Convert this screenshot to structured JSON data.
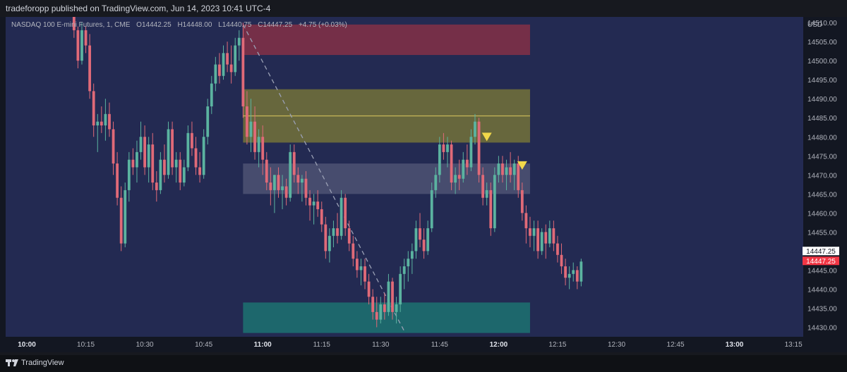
{
  "header": {
    "publisher_line": "tradeforopp published on TradingView.com, Jun 14, 2023 10:41 UTC-4"
  },
  "legend": {
    "symbol": "NASDAQ 100 E-mini Futures, 1, CME",
    "open": "O14442.25",
    "high": "H14448.00",
    "low": "L14440.75",
    "close": "C14447.25",
    "change": "+4.75 (+0.03%)"
  },
  "price_axis": {
    "currency": "USD",
    "last_price": "14447.25",
    "last_price_red": "14447.25"
  },
  "footer": {
    "brand": "TradingView"
  },
  "colors": {
    "up": "#5bb3a0",
    "down": "#e06a78",
    "background": "#232a52",
    "supply_zone": "#7a2f48",
    "premium_zone": "#6b6a3c",
    "fvg_zone": "#4a4e70",
    "demand_zone": "#1e6a6e",
    "marker": "#f2d84a"
  },
  "chart_data": {
    "type": "candlestick",
    "title": "",
    "ylim": [
      14427.5,
      14511.5
    ],
    "x_ticks": [
      {
        "label": "10:00",
        "minute": 0,
        "bold": true
      },
      {
        "label": "10:15",
        "minute": 15
      },
      {
        "label": "10:30",
        "minute": 30
      },
      {
        "label": "10:45",
        "minute": 45
      },
      {
        "label": "11:00",
        "minute": 60,
        "bold": true
      },
      {
        "label": "11:15",
        "minute": 75
      },
      {
        "label": "11:30",
        "minute": 90
      },
      {
        "label": "11:45",
        "minute": 105
      },
      {
        "label": "12:00",
        "minute": 120,
        "bold": true
      },
      {
        "label": "12:15",
        "minute": 135
      },
      {
        "label": "12:30",
        "minute": 150
      },
      {
        "label": "12:45",
        "minute": 165
      },
      {
        "label": "13:00",
        "minute": 180,
        "bold": true
      },
      {
        "label": "13:15",
        "minute": 195
      }
    ],
    "y_ticks": [
      14510,
      14505,
      14500,
      14495,
      14490,
      14485,
      14480,
      14475,
      14470,
      14465,
      14460,
      14455,
      14450,
      14445,
      14440,
      14435,
      14430
    ],
    "y_tick_labels": [
      "14510.00",
      "14505.00",
      "14500.00",
      "14495.00",
      "14490.00",
      "14485.00",
      "14480.00",
      "14475.00",
      "14470.00",
      "14465.00",
      "14460.00",
      "14455.00",
      "14450.00",
      "14445.00",
      "14440.00",
      "14435.00",
      "14430.00"
    ],
    "zones": [
      {
        "name": "supply",
        "from_minute": 55,
        "to_minute": 128,
        "top": 14509.5,
        "bottom": 14501.5
      },
      {
        "name": "premium",
        "from_minute": 55,
        "to_minute": 128,
        "top": 14492.5,
        "bottom": 14478.5
      },
      {
        "name": "fvg",
        "from_minute": 55,
        "to_minute": 128,
        "top": 14473.0,
        "bottom": 14465.0
      },
      {
        "name": "demand",
        "from_minute": 55,
        "to_minute": 128,
        "top": 14436.5,
        "bottom": 14428.5
      }
    ],
    "lines": [
      {
        "name": "premium-mid",
        "from_minute": 55,
        "to_minute": 128,
        "y1": 14485.5,
        "y2": 14485.5,
        "dashed": false
      },
      {
        "name": "dashed-path",
        "from_minute": 55,
        "to_minute": 96,
        "y1": 14509.5,
        "y2": 14429.0,
        "dashed": true
      }
    ],
    "markers": [
      {
        "minute": 117,
        "price": 14478.5
      },
      {
        "minute": 126,
        "price": 14471.0
      }
    ],
    "candles": [
      {
        "t": 12,
        "o": 14512.0,
        "h": 14514.0,
        "l": 14506.0,
        "c": 14508.0
      },
      {
        "t": 13,
        "o": 14508.0,
        "h": 14509.0,
        "l": 14498.0,
        "c": 14500.0
      },
      {
        "t": 14,
        "o": 14500.0,
        "h": 14510.0,
        "l": 14499.0,
        "c": 14508.0
      },
      {
        "t": 15,
        "o": 14508.0,
        "h": 14509.0,
        "l": 14502.0,
        "c": 14504.0
      },
      {
        "t": 16,
        "o": 14504.0,
        "h": 14507.0,
        "l": 14490.0,
        "c": 14492.0
      },
      {
        "t": 17,
        "o": 14492.0,
        "h": 14494.0,
        "l": 14480.0,
        "c": 14483.0
      },
      {
        "t": 18,
        "o": 14483.0,
        "h": 14486.0,
        "l": 14476.0,
        "c": 14484.0
      },
      {
        "t": 19,
        "o": 14484.0,
        "h": 14488.0,
        "l": 14481.0,
        "c": 14483.0
      },
      {
        "t": 20,
        "o": 14483.0,
        "h": 14490.0,
        "l": 14479.0,
        "c": 14486.0
      },
      {
        "t": 21,
        "o": 14486.0,
        "h": 14489.0,
        "l": 14480.0,
        "c": 14482.0
      },
      {
        "t": 22,
        "o": 14482.0,
        "h": 14484.0,
        "l": 14470.0,
        "c": 14473.0
      },
      {
        "t": 23,
        "o": 14473.0,
        "h": 14476.0,
        "l": 14462.0,
        "c": 14464.0
      },
      {
        "t": 24,
        "o": 14464.0,
        "h": 14467.0,
        "l": 14450.0,
        "c": 14452.0
      },
      {
        "t": 25,
        "o": 14452.0,
        "h": 14468.0,
        "l": 14451.0,
        "c": 14466.0
      },
      {
        "t": 26,
        "o": 14466.0,
        "h": 14476.0,
        "l": 14463.0,
        "c": 14474.0
      },
      {
        "t": 27,
        "o": 14474.0,
        "h": 14477.0,
        "l": 14470.0,
        "c": 14472.0
      },
      {
        "t": 28,
        "o": 14472.0,
        "h": 14479.0,
        "l": 14468.0,
        "c": 14476.0
      },
      {
        "t": 29,
        "o": 14476.0,
        "h": 14484.0,
        "l": 14474.0,
        "c": 14480.0
      },
      {
        "t": 30,
        "o": 14480.0,
        "h": 14483.0,
        "l": 14470.0,
        "c": 14472.0
      },
      {
        "t": 31,
        "o": 14472.0,
        "h": 14480.0,
        "l": 14468.0,
        "c": 14478.0
      },
      {
        "t": 32,
        "o": 14478.0,
        "h": 14481.0,
        "l": 14466.0,
        "c": 14468.0
      },
      {
        "t": 33,
        "o": 14468.0,
        "h": 14471.0,
        "l": 14463.0,
        "c": 14466.0
      },
      {
        "t": 34,
        "o": 14466.0,
        "h": 14476.0,
        "l": 14465.0,
        "c": 14474.0
      },
      {
        "t": 35,
        "o": 14474.0,
        "h": 14478.0,
        "l": 14468.0,
        "c": 14470.0
      },
      {
        "t": 36,
        "o": 14470.0,
        "h": 14484.0,
        "l": 14469.0,
        "c": 14482.0
      },
      {
        "t": 37,
        "o": 14482.0,
        "h": 14484.0,
        "l": 14470.0,
        "c": 14472.0
      },
      {
        "t": 38,
        "o": 14472.0,
        "h": 14476.0,
        "l": 14468.0,
        "c": 14474.0
      },
      {
        "t": 39,
        "o": 14474.0,
        "h": 14476.0,
        "l": 14466.0,
        "c": 14468.0
      },
      {
        "t": 40,
        "o": 14468.0,
        "h": 14474.0,
        "l": 14467.0,
        "c": 14472.0
      },
      {
        "t": 41,
        "o": 14472.0,
        "h": 14483.0,
        "l": 14471.0,
        "c": 14481.0
      },
      {
        "t": 42,
        "o": 14481.0,
        "h": 14484.0,
        "l": 14475.0,
        "c": 14477.0
      },
      {
        "t": 43,
        "o": 14477.0,
        "h": 14480.0,
        "l": 14470.0,
        "c": 14472.0
      },
      {
        "t": 44,
        "o": 14472.0,
        "h": 14476.0,
        "l": 14468.0,
        "c": 14470.0
      },
      {
        "t": 45,
        "o": 14470.0,
        "h": 14482.0,
        "l": 14469.0,
        "c": 14480.0
      },
      {
        "t": 46,
        "o": 14480.0,
        "h": 14490.0,
        "l": 14478.0,
        "c": 14488.0
      },
      {
        "t": 47,
        "o": 14488.0,
        "h": 14496.0,
        "l": 14486.0,
        "c": 14494.0
      },
      {
        "t": 48,
        "o": 14494.0,
        "h": 14501.0,
        "l": 14492.0,
        "c": 14499.0
      },
      {
        "t": 49,
        "o": 14499.0,
        "h": 14502.0,
        "l": 14494.0,
        "c": 14496.0
      },
      {
        "t": 50,
        "o": 14496.0,
        "h": 14504.0,
        "l": 14495.0,
        "c": 14502.0
      },
      {
        "t": 51,
        "o": 14502.0,
        "h": 14505.0,
        "l": 14497.0,
        "c": 14499.0
      },
      {
        "t": 52,
        "o": 14499.0,
        "h": 14504.0,
        "l": 14494.0,
        "c": 14497.0
      },
      {
        "t": 53,
        "o": 14497.0,
        "h": 14506.0,
        "l": 14496.0,
        "c": 14504.0
      },
      {
        "t": 54,
        "o": 14504.0,
        "h": 14508.0,
        "l": 14500.0,
        "c": 14506.0
      },
      {
        "t": 55,
        "o": 14506.0,
        "h": 14510.0,
        "l": 14485.0,
        "c": 14488.0
      },
      {
        "t": 56,
        "o": 14488.0,
        "h": 14492.0,
        "l": 14478.0,
        "c": 14480.0
      },
      {
        "t": 57,
        "o": 14480.0,
        "h": 14490.0,
        "l": 14476.0,
        "c": 14484.0
      },
      {
        "t": 58,
        "o": 14484.0,
        "h": 14488.0,
        "l": 14474.0,
        "c": 14476.0
      },
      {
        "t": 59,
        "o": 14476.0,
        "h": 14482.0,
        "l": 14472.0,
        "c": 14480.0
      },
      {
        "t": 60,
        "o": 14480.0,
        "h": 14483.0,
        "l": 14470.0,
        "c": 14474.0
      },
      {
        "t": 61,
        "o": 14474.0,
        "h": 14476.0,
        "l": 14466.0,
        "c": 14468.0
      },
      {
        "t": 62,
        "o": 14468.0,
        "h": 14472.0,
        "l": 14462.0,
        "c": 14466.0
      },
      {
        "t": 63,
        "o": 14466.0,
        "h": 14470.0,
        "l": 14460.0,
        "c": 14470.0
      },
      {
        "t": 64,
        "o": 14470.0,
        "h": 14472.0,
        "l": 14464.0,
        "c": 14466.0
      },
      {
        "t": 65,
        "o": 14466.0,
        "h": 14470.0,
        "l": 14461.0,
        "c": 14467.0
      },
      {
        "t": 66,
        "o": 14467.0,
        "h": 14469.0,
        "l": 14462.0,
        "c": 14464.0
      },
      {
        "t": 67,
        "o": 14464.0,
        "h": 14478.0,
        "l": 14463.0,
        "c": 14476.0
      },
      {
        "t": 68,
        "o": 14476.0,
        "h": 14478.0,
        "l": 14468.0,
        "c": 14470.0
      },
      {
        "t": 69,
        "o": 14470.0,
        "h": 14472.0,
        "l": 14465.0,
        "c": 14468.0
      },
      {
        "t": 70,
        "o": 14468.0,
        "h": 14470.0,
        "l": 14463.0,
        "c": 14469.0
      },
      {
        "t": 71,
        "o": 14469.0,
        "h": 14471.0,
        "l": 14462.0,
        "c": 14464.0
      },
      {
        "t": 72,
        "o": 14464.0,
        "h": 14466.0,
        "l": 14458.0,
        "c": 14462.0
      },
      {
        "t": 73,
        "o": 14462.0,
        "h": 14465.0,
        "l": 14457.0,
        "c": 14463.0
      },
      {
        "t": 74,
        "o": 14463.0,
        "h": 14466.0,
        "l": 14459.0,
        "c": 14461.0
      },
      {
        "t": 75,
        "o": 14461.0,
        "h": 14463.0,
        "l": 14455.0,
        "c": 14457.0
      },
      {
        "t": 76,
        "o": 14457.0,
        "h": 14459.0,
        "l": 14448.0,
        "c": 14450.0
      },
      {
        "t": 77,
        "o": 14450.0,
        "h": 14456.0,
        "l": 14447.0,
        "c": 14454.0
      },
      {
        "t": 78,
        "o": 14454.0,
        "h": 14458.0,
        "l": 14451.0,
        "c": 14456.0
      },
      {
        "t": 79,
        "o": 14456.0,
        "h": 14460.0,
        "l": 14452.0,
        "c": 14454.0
      },
      {
        "t": 80,
        "o": 14454.0,
        "h": 14466.0,
        "l": 14453.0,
        "c": 14464.0
      },
      {
        "t": 81,
        "o": 14464.0,
        "h": 14465.0,
        "l": 14454.0,
        "c": 14456.0
      },
      {
        "t": 82,
        "o": 14456.0,
        "h": 14458.0,
        "l": 14450.0,
        "c": 14452.0
      },
      {
        "t": 83,
        "o": 14452.0,
        "h": 14454.0,
        "l": 14446.0,
        "c": 14448.0
      },
      {
        "t": 84,
        "o": 14448.0,
        "h": 14450.0,
        "l": 14443.0,
        "c": 14445.0
      },
      {
        "t": 85,
        "o": 14445.0,
        "h": 14448.0,
        "l": 14441.0,
        "c": 14446.0
      },
      {
        "t": 86,
        "o": 14446.0,
        "h": 14448.0,
        "l": 14440.0,
        "c": 14442.0
      },
      {
        "t": 87,
        "o": 14442.0,
        "h": 14444.0,
        "l": 14436.0,
        "c": 14438.0
      },
      {
        "t": 88,
        "o": 14438.0,
        "h": 14440.0,
        "l": 14432.0,
        "c": 14434.0
      },
      {
        "t": 89,
        "o": 14434.0,
        "h": 14438.0,
        "l": 14430.0,
        "c": 14432.0
      },
      {
        "t": 90,
        "o": 14432.0,
        "h": 14438.0,
        "l": 14431.0,
        "c": 14436.0
      },
      {
        "t": 91,
        "o": 14436.0,
        "h": 14439.0,
        "l": 14432.0,
        "c": 14434.0
      },
      {
        "t": 92,
        "o": 14434.0,
        "h": 14444.0,
        "l": 14433.0,
        "c": 14442.0
      },
      {
        "t": 93,
        "o": 14442.0,
        "h": 14443.0,
        "l": 14432.0,
        "c": 14434.0
      },
      {
        "t": 94,
        "o": 14434.0,
        "h": 14438.0,
        "l": 14431.0,
        "c": 14436.0
      },
      {
        "t": 95,
        "o": 14436.0,
        "h": 14446.0,
        "l": 14434.0,
        "c": 14444.0
      },
      {
        "t": 96,
        "o": 14444.0,
        "h": 14448.0,
        "l": 14440.0,
        "c": 14446.0
      },
      {
        "t": 97,
        "o": 14446.0,
        "h": 14450.0,
        "l": 14442.0,
        "c": 14448.0
      },
      {
        "t": 98,
        "o": 14448.0,
        "h": 14452.0,
        "l": 14444.0,
        "c": 14450.0
      },
      {
        "t": 99,
        "o": 14450.0,
        "h": 14458.0,
        "l": 14448.0,
        "c": 14456.0
      },
      {
        "t": 100,
        "o": 14456.0,
        "h": 14460.0,
        "l": 14451.0,
        "c": 14453.0
      },
      {
        "t": 101,
        "o": 14453.0,
        "h": 14456.0,
        "l": 14448.0,
        "c": 14450.0
      },
      {
        "t": 102,
        "o": 14450.0,
        "h": 14458.0,
        "l": 14449.0,
        "c": 14456.0
      },
      {
        "t": 103,
        "o": 14456.0,
        "h": 14468.0,
        "l": 14455.0,
        "c": 14466.0
      },
      {
        "t": 104,
        "o": 14466.0,
        "h": 14472.0,
        "l": 14464.0,
        "c": 14470.0
      },
      {
        "t": 105,
        "o": 14470.0,
        "h": 14480.0,
        "l": 14468.0,
        "c": 14478.0
      },
      {
        "t": 106,
        "o": 14478.0,
        "h": 14481.0,
        "l": 14474.0,
        "c": 14476.0
      },
      {
        "t": 107,
        "o": 14476.0,
        "h": 14480.0,
        "l": 14472.0,
        "c": 14478.0
      },
      {
        "t": 108,
        "o": 14478.0,
        "h": 14479.0,
        "l": 14466.0,
        "c": 14468.0
      },
      {
        "t": 109,
        "o": 14468.0,
        "h": 14472.0,
        "l": 14465.0,
        "c": 14470.0
      },
      {
        "t": 110,
        "o": 14470.0,
        "h": 14474.0,
        "l": 14466.0,
        "c": 14469.0
      },
      {
        "t": 111,
        "o": 14469.0,
        "h": 14476.0,
        "l": 14468.0,
        "c": 14474.0
      },
      {
        "t": 112,
        "o": 14474.0,
        "h": 14478.0,
        "l": 14470.0,
        "c": 14472.0
      },
      {
        "t": 113,
        "o": 14472.0,
        "h": 14482.0,
        "l": 14471.0,
        "c": 14480.0
      },
      {
        "t": 114,
        "o": 14480.0,
        "h": 14486.0,
        "l": 14478.0,
        "c": 14484.0
      },
      {
        "t": 115,
        "o": 14484.0,
        "h": 14485.0,
        "l": 14468.0,
        "c": 14470.0
      },
      {
        "t": 116,
        "o": 14470.0,
        "h": 14472.0,
        "l": 14462.0,
        "c": 14464.0
      },
      {
        "t": 117,
        "o": 14464.0,
        "h": 14468.0,
        "l": 14462.0,
        "c": 14466.0
      },
      {
        "t": 118,
        "o": 14466.0,
        "h": 14468.0,
        "l": 14454.0,
        "c": 14456.0
      },
      {
        "t": 119,
        "o": 14456.0,
        "h": 14472.0,
        "l": 14455.0,
        "c": 14470.0
      },
      {
        "t": 120,
        "o": 14470.0,
        "h": 14475.0,
        "l": 14468.0,
        "c": 14473.0
      },
      {
        "t": 121,
        "o": 14473.0,
        "h": 14475.0,
        "l": 14468.0,
        "c": 14470.0
      },
      {
        "t": 122,
        "o": 14470.0,
        "h": 14474.0,
        "l": 14466.0,
        "c": 14472.0
      },
      {
        "t": 123,
        "o": 14472.0,
        "h": 14476.0,
        "l": 14468.0,
        "c": 14470.0
      },
      {
        "t": 124,
        "o": 14470.0,
        "h": 14474.0,
        "l": 14466.0,
        "c": 14473.0
      },
      {
        "t": 125,
        "o": 14473.0,
        "h": 14475.0,
        "l": 14464.0,
        "c": 14466.0
      },
      {
        "t": 126,
        "o": 14466.0,
        "h": 14468.0,
        "l": 14458.0,
        "c": 14460.0
      },
      {
        "t": 127,
        "o": 14460.0,
        "h": 14462.0,
        "l": 14452.0,
        "c": 14456.0
      },
      {
        "t": 128,
        "o": 14456.0,
        "h": 14459.0,
        "l": 14451.0,
        "c": 14454.0
      },
      {
        "t": 129,
        "o": 14454.0,
        "h": 14458.0,
        "l": 14450.0,
        "c": 14456.0
      },
      {
        "t": 130,
        "o": 14456.0,
        "h": 14458.0,
        "l": 14448.0,
        "c": 14450.0
      },
      {
        "t": 131,
        "o": 14450.0,
        "h": 14456.0,
        "l": 14449.0,
        "c": 14455.0
      },
      {
        "t": 132,
        "o": 14455.0,
        "h": 14457.0,
        "l": 14448.0,
        "c": 14452.0
      },
      {
        "t": 133,
        "o": 14452.0,
        "h": 14458.0,
        "l": 14451.0,
        "c": 14456.0
      },
      {
        "t": 134,
        "o": 14456.0,
        "h": 14458.0,
        "l": 14450.0,
        "c": 14452.0
      },
      {
        "t": 135,
        "o": 14452.0,
        "h": 14454.0,
        "l": 14447.0,
        "c": 14449.0
      },
      {
        "t": 136,
        "o": 14449.0,
        "h": 14452.0,
        "l": 14444.0,
        "c": 14446.0
      },
      {
        "t": 137,
        "o": 14446.0,
        "h": 14448.0,
        "l": 14441.0,
        "c": 14443.0
      },
      {
        "t": 138,
        "o": 14443.0,
        "h": 14446.0,
        "l": 14440.0,
        "c": 14444.0
      },
      {
        "t": 139,
        "o": 14444.0,
        "h": 14447.0,
        "l": 14442.0,
        "c": 14445.0
      },
      {
        "t": 140,
        "o": 14445.0,
        "h": 14446.0,
        "l": 14440.0,
        "c": 14442.0
      },
      {
        "t": 141,
        "o": 14442.0,
        "h": 14448.0,
        "l": 14440.75,
        "c": 14447.25
      }
    ]
  }
}
